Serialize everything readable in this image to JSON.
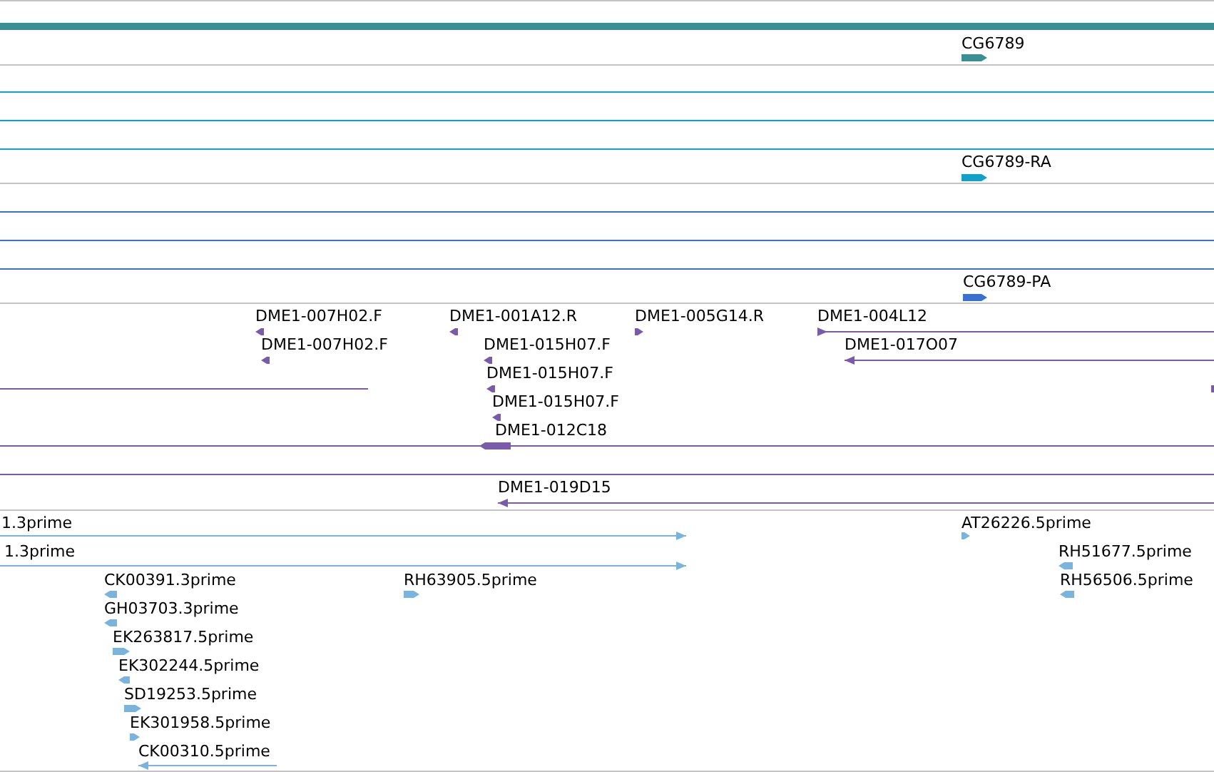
{
  "tracks": [
    {
      "color": "#3a8f94",
      "features": [
        {
          "label": "CG6789",
          "reverse": false
        }
      ]
    },
    {
      "color": "#10a0c8",
      "features": [
        {
          "label": "CG6789-RA",
          "reverse": false
        }
      ]
    },
    {
      "color": "#3a70d0",
      "features": [
        {
          "label": "CG6789-PA",
          "reverse": false
        }
      ]
    },
    {
      "color": "#7a5aaa",
      "features": [
        {
          "label": "DME1-007H02.F",
          "reverse": true
        },
        {
          "label": "DME1-001A12.R",
          "reverse": true
        },
        {
          "label": "DME1-005G14.R",
          "reverse": false
        },
        {
          "label": "DME1-004L12",
          "reverse": false
        },
        {
          "label": "DME1-007H02.F",
          "reverse": true
        },
        {
          "label": "DME1-015H07.F",
          "reverse": true
        },
        {
          "label": "DME1-017O07",
          "reverse": true
        },
        {
          "label": "DME1-015H07.F",
          "reverse": true
        },
        {
          "label": "DME1-015H07.F",
          "reverse": true
        },
        {
          "label": "DME1-012C18",
          "reverse": true
        },
        {
          "label": "DME1-019D15",
          "reverse": true
        }
      ]
    },
    {
      "color": "#7ab4dc",
      "features": [
        {
          "label": "1.3prime",
          "reverse": false
        },
        {
          "label": "AT26226.5prime",
          "reverse": false
        },
        {
          "label": "1.3prime",
          "reverse": false
        },
        {
          "label": "RH51677.5prime",
          "reverse": true
        },
        {
          "label": "CK00391.3prime",
          "reverse": true
        },
        {
          "label": "RH63905.5prime",
          "reverse": false
        },
        {
          "label": "RH56506.5prime",
          "reverse": true
        },
        {
          "label": "GH03703.3prime",
          "reverse": true
        },
        {
          "label": "EK263817.5prime",
          "reverse": false
        },
        {
          "label": "EK302244.5prime",
          "reverse": true
        },
        {
          "label": "SD19253.5prime",
          "reverse": false
        },
        {
          "label": "EK301958.5prime",
          "reverse": false
        },
        {
          "label": "CK00310.5prime",
          "reverse": true
        }
      ]
    }
  ]
}
